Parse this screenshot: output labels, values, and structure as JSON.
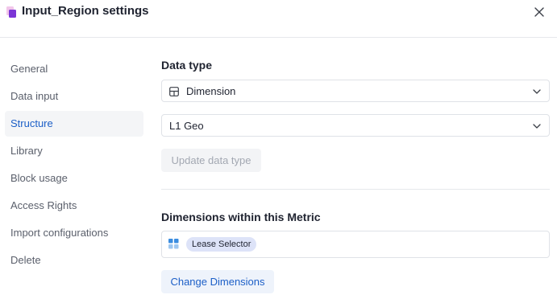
{
  "dialog": {
    "title": "Input_Region settings",
    "icon": "block-icon",
    "close_icon": "close-icon"
  },
  "sidebar": {
    "items": [
      {
        "label": "General",
        "active": false
      },
      {
        "label": "Data input",
        "active": false
      },
      {
        "label": "Structure",
        "active": true
      },
      {
        "label": "Library",
        "active": false
      },
      {
        "label": "Block usage",
        "active": false
      },
      {
        "label": "Access Rights",
        "active": false
      },
      {
        "label": "Import configurations",
        "active": false
      },
      {
        "label": "Delete",
        "active": false
      }
    ]
  },
  "structure": {
    "data_type_heading": "Data type",
    "data_type_select": {
      "value": "Dimension",
      "icon": "table-icon"
    },
    "dimension_select": {
      "value": "L1 Geo"
    },
    "update_button": "Update data type",
    "dimensions_heading": "Dimensions within this Metric",
    "dimensions": [
      {
        "label": "Lease Selector",
        "icon": "grid-icon"
      }
    ],
    "change_button": "Change Dimensions"
  },
  "colors": {
    "accent": "#1c5fc7",
    "chip_bg": "#dde3f8",
    "icon_pink": "#e79ad6",
    "icon_purple": "#7b35d6",
    "grid_blue": "#3b8de0"
  }
}
